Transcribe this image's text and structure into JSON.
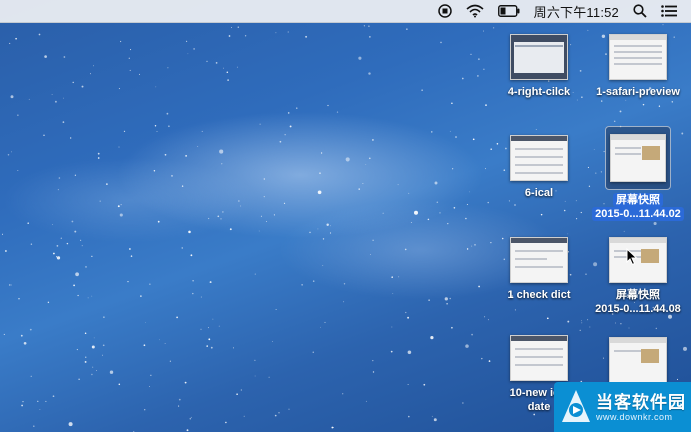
{
  "menubar": {
    "clock": "周六下午11:52",
    "icons": [
      "record-stop-icon",
      "wifi-icon",
      "battery-icon",
      "search-icon",
      "notification-center-icon"
    ]
  },
  "desktop": {
    "items": [
      {
        "label": "4-right-cilck",
        "label2": ""
      },
      {
        "label": "1-safari-preview",
        "label2": ""
      },
      {
        "label": "6-ical",
        "label2": ""
      },
      {
        "label": "屏幕快照",
        "label2": "2015-0...11.44.02",
        "selected": true
      },
      {
        "label": "1 check dict",
        "label2": ""
      },
      {
        "label": "屏幕快照",
        "label2": "2015-0...11.44.08"
      },
      {
        "label": "10-new ical",
        "label2": "date"
      },
      {
        "label": "",
        "label2": ""
      }
    ]
  },
  "watermark": {
    "name": "当客软件园",
    "url": "www.downkr.com"
  },
  "colors": {
    "selection": "#2b6ad8",
    "watermark_bg": "#0b8fd3",
    "desktop_base": "#2f6cbc"
  }
}
